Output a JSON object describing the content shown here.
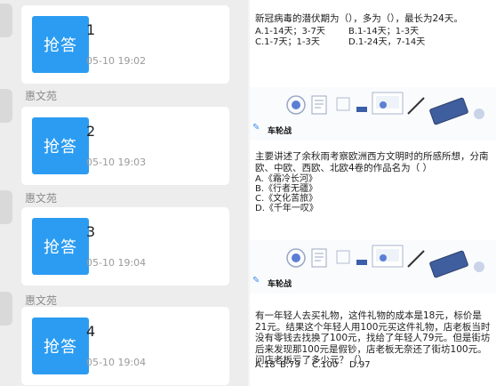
{
  "chat": {
    "cards": [
      {
        "sender": "",
        "icon_label": "抢答",
        "number": "1",
        "time": "05-10 19:02"
      },
      {
        "sender": "惠文苑",
        "icon_label": "抢答",
        "number": "2",
        "time": "05-10 19:03"
      },
      {
        "sender": "惠文苑",
        "icon_label": "抢答",
        "number": "3",
        "time": "05-10 19:04"
      },
      {
        "sender": "惠文苑",
        "icon_label": "抢答",
        "number": "4",
        "time": "05-10 19:04"
      }
    ]
  },
  "questions": {
    "q1": {
      "text": "新冠病毒的潜伏期为（），多为（），最长为24天。",
      "options_row1_a": "A.1-14天；3-7天",
      "options_row1_b": "B.1-14天；1-3天",
      "options_row2_a": "C.1-7天；1-3天",
      "options_row2_b": "D.1-24天，7-14天"
    },
    "banner1_title": "车轮战",
    "q2": {
      "text": "主要讲述了余秋雨考察欧洲西方文明时的所感所想，分南欧、中欧、西欧、北欧4卷的作品名为（ ）",
      "options": [
        "A.《霜冷长河》",
        "B.《行者无疆》",
        "C.《文化苦旅》",
        "D.《千年一叹》"
      ]
    },
    "banner2_title": "车轮战",
    "q3": {
      "text": "有一年轻人去买礼物，这件礼物的成本是18元，标价是21元。结果这个年轻人用100元买这件礼物，店老板当时没有零钱去找换了100元，找给了年轻人79元。但是街坊后来发现那100元是假钞，店老板无奈还了街坊100元。问店老板亏了多少元？（）",
      "options_row": [
        "A.18",
        "B.79",
        "C.100",
        "D.97"
      ]
    }
  },
  "colors": {
    "chat_bg": "#ededed",
    "card_icon": "#2b9cf2",
    "banner_icon": "#3b8fe6"
  }
}
